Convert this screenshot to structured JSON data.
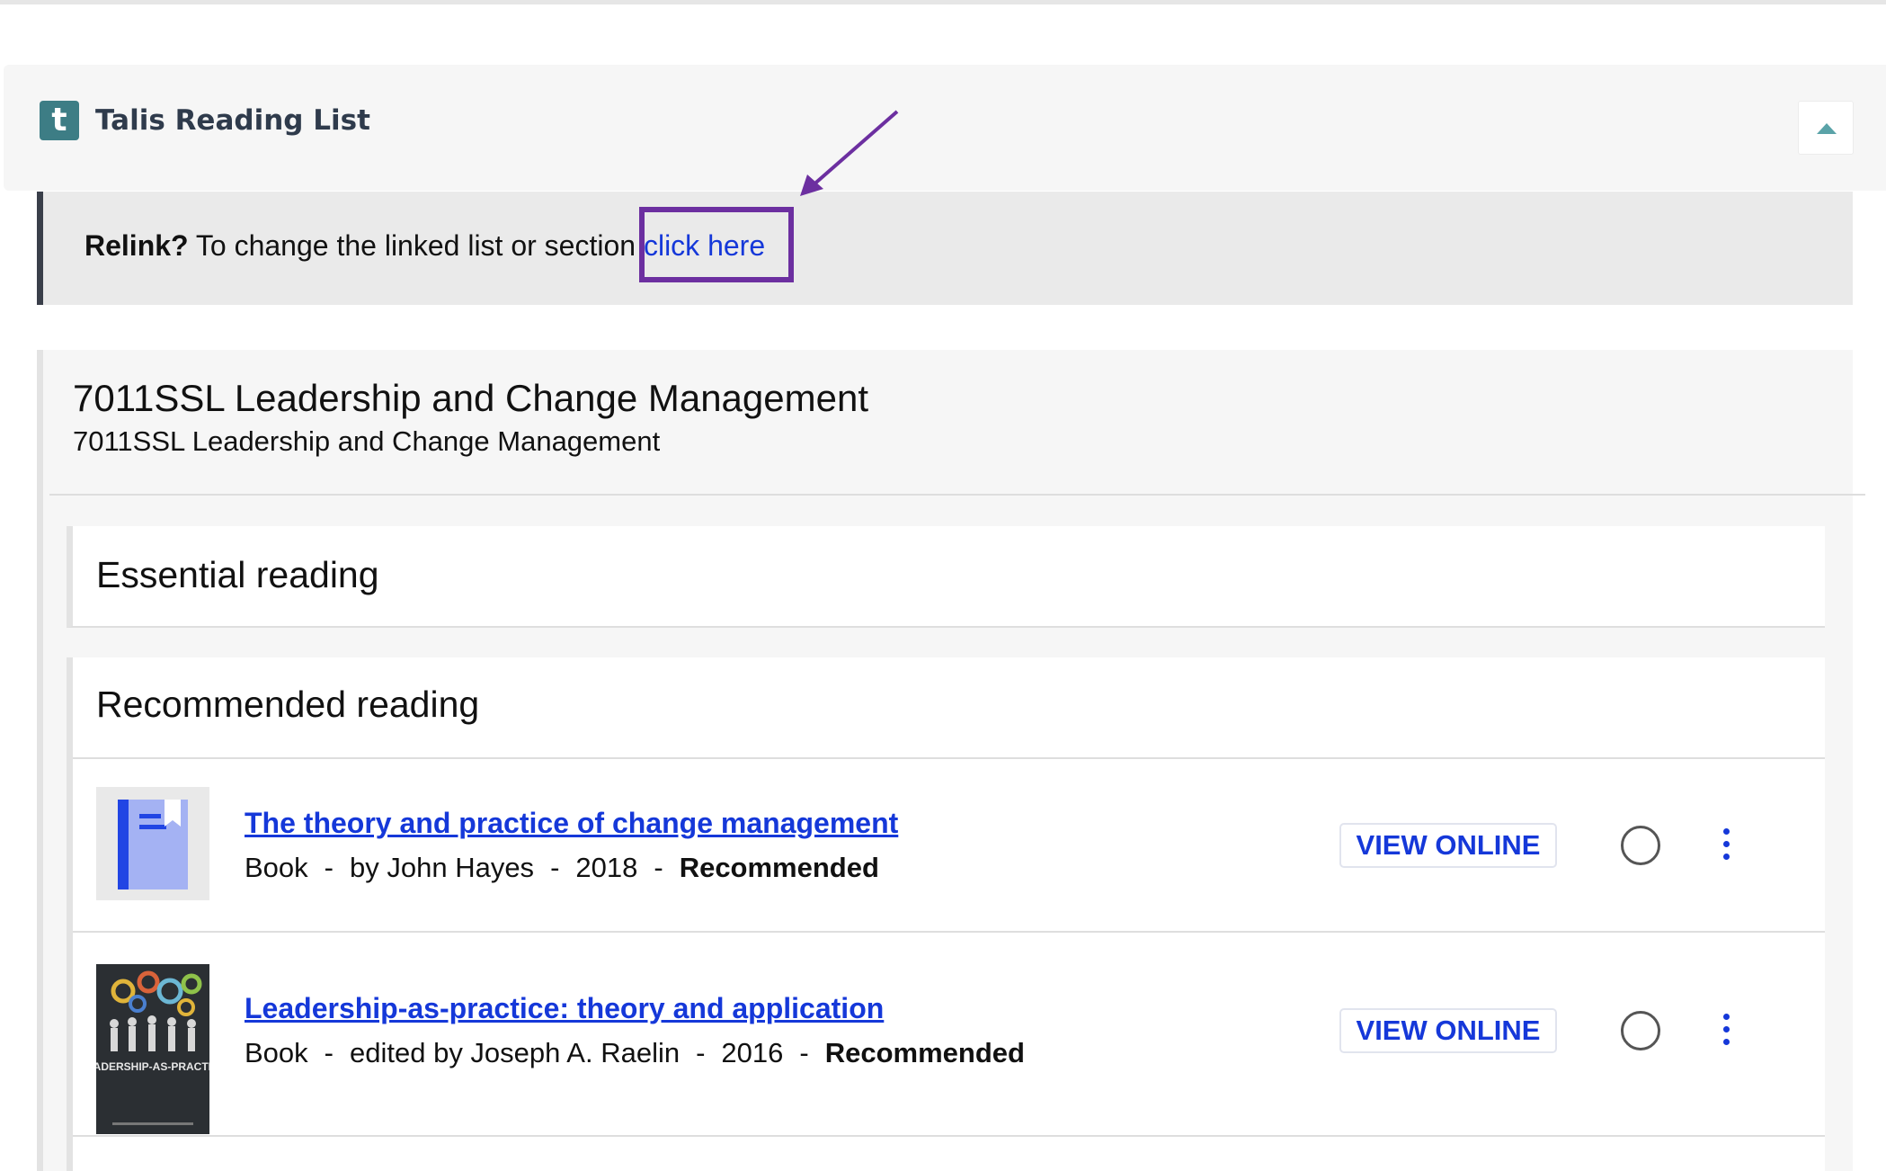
{
  "talis": {
    "logo_letter": "t",
    "title": "Talis Reading List",
    "collapse_icon": "chevron-up-icon"
  },
  "relink": {
    "label": "Relink?",
    "text": " To change the linked list or section ",
    "link": "click here"
  },
  "list": {
    "title": "7011SSL Leadership and Change Management",
    "subtitle": "7011SSL Leadership and Change Management"
  },
  "sections": {
    "essential": {
      "heading": "Essential reading"
    },
    "recommended": {
      "heading": "Recommended reading",
      "items": [
        {
          "title": "The theory and practice of change management",
          "type": "Book",
          "author": "by John Hayes",
          "year": "2018",
          "importance": "Recommended",
          "action": "VIEW ONLINE"
        },
        {
          "title": "Leadership-as-practice: theory and application",
          "type": "Book",
          "author": "edited by Joseph A. Raelin",
          "year": "2016",
          "importance": "Recommended",
          "action": "VIEW ONLINE",
          "cover_text": "LEADERSHIP-AS-PRACTICE"
        }
      ]
    }
  },
  "colors": {
    "link": "#1538d9",
    "talis_teal": "#3d7d85",
    "highlight": "#6c2fa0"
  }
}
